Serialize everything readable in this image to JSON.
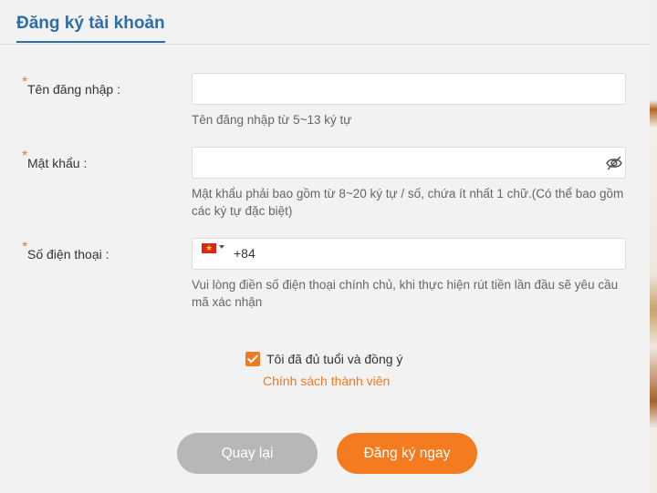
{
  "header": {
    "title": "Đăng ký tài khoản"
  },
  "form": {
    "username": {
      "label": "Tên đăng nhập :",
      "value": "",
      "hint": "Tên đăng nhập từ 5~13 ký tự"
    },
    "password": {
      "label": "Mật khẩu :",
      "value": "",
      "hint": "Mật khẩu phải bao gồm từ 8~20 ký tự / số, chứa ít nhất 1 chữ.(Có thể bao gồm các ký tự đặc biệt)",
      "toggle_icon": "eye-slash-icon"
    },
    "phone": {
      "label": "Số điện thoại :",
      "country_flag": "vietnam-flag-icon",
      "dial_code": "+84",
      "value": "",
      "hint": "Vui lòng điền số điện thoại chính chủ, khi thực hiện rút tiền lần đầu sẽ yêu cầu mã xác nhận"
    },
    "required_mark": "*"
  },
  "agreement": {
    "checked": true,
    "text": "Tôi đã đủ tuổi và đồng ý",
    "policy_link": "Chính sách thành viên"
  },
  "buttons": {
    "back_label": "Quay lại",
    "submit_label": "Đăng ký ngay"
  },
  "colors": {
    "accent": "#f07a20",
    "title": "#2e6ea8",
    "back_button": "#b7b7b7",
    "submit_button": "#f47b20"
  }
}
